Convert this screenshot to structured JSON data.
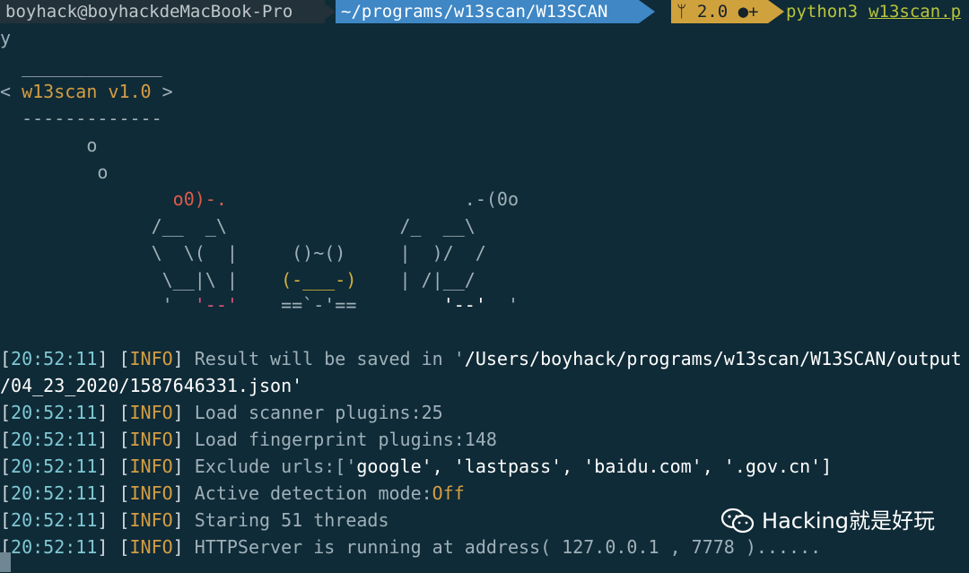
{
  "prompt": {
    "user_host": "boyhack@boyhackdeMacBook-Pro",
    "path": "~/programs/w13scan/W13SCAN",
    "git_icon": "git-branch-icon",
    "git_label": "2.0 ●+",
    "command": "python3",
    "command_arg": "w13scan.p"
  },
  "ascii": {
    "l0": "y",
    "l1": "  _____________",
    "l2_a": "< ",
    "l2_b": "w13scan v1.0",
    "l2_c": " >",
    "l3": "  -------------",
    "l4": "        o",
    "l5": "         o",
    "l6_red": "                o0)-.",
    "l6_rest": "                      .-(0o",
    "l7": "              /__  _\\                /_  __\\",
    "l8": "              \\  \\(  |     ()~()     |  )/  /",
    "l9_a": "               \\__|\\ |    ",
    "l9_b": "(-___-)",
    "l9_c": "    | /|__/",
    "l10_a": "               '  ",
    "l10_b": "'--'",
    "l10_c": "    ==`-'==        ",
    "l10_d": "'--'",
    "l10_e": "  '"
  },
  "log": [
    {
      "ts": "20:52:11",
      "tag": "INFO",
      "pre": "Result will be saved in '",
      "val": "/Users/boyhack/programs/w13scan/W13SCAN/output",
      "post": ""
    },
    {
      "ts": "",
      "tag": "",
      "pre": "/04_23_2020/1587646331.json'",
      "val": "",
      "post": ""
    },
    {
      "ts": "20:52:11",
      "tag": "INFO",
      "pre": "Load scanner plugins:25",
      "val": "",
      "post": ""
    },
    {
      "ts": "20:52:11",
      "tag": "INFO",
      "pre": "Load fingerprint plugins:148",
      "val": "",
      "post": ""
    },
    {
      "ts": "20:52:11",
      "tag": "INFO",
      "pre": "Exclude urls:['",
      "val": "google",
      "post": "', 'lastpass', 'baidu.com', '.gov.cn']"
    },
    {
      "ts": "20:52:11",
      "tag": "INFO",
      "pre": "Active detection mode:",
      "val": "Off",
      "post": ""
    },
    {
      "ts": "20:52:11",
      "tag": "INFO",
      "pre": "Staring 51 threads",
      "val": "",
      "post": ""
    },
    {
      "ts": "20:52:11",
      "tag": "INFO",
      "pre": "HTTPServer is running at address( 127.0.0.1 , 7778 )......",
      "val": "",
      "post": ""
    }
  ],
  "watermark": {
    "icon": "wechat-icon",
    "text": "Hacking就是好玩"
  },
  "colors": {
    "background": "#0f2b37",
    "path_segment": "#3f87c5",
    "git_segment": "#d0a23d",
    "info_tag": "#d59d43",
    "timestamp": "#7fc8d4"
  }
}
